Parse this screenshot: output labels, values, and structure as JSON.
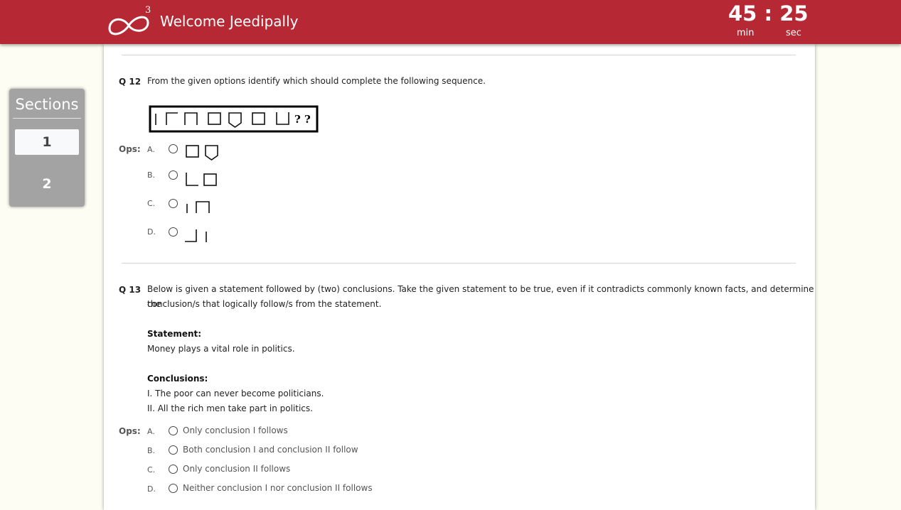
{
  "header": {
    "logo_superscript": "3",
    "welcome": "Welcome Jeedipally",
    "timer": {
      "minutes": "45",
      "separator": ":",
      "seconds": "25",
      "min_label": "min",
      "sec_label": "sec"
    }
  },
  "sidebar": {
    "title": "Sections",
    "items": [
      {
        "label": "1",
        "active": true
      },
      {
        "label": "2",
        "active": false
      }
    ]
  },
  "questions": [
    {
      "number": "Q 12",
      "text": "From the given options identify which should complete the following sequence.",
      "sequence_figure": {
        "shapes": [
          "vertical-bar",
          "corner-top-left",
          "open-bottom-square",
          "square",
          "shield",
          "square",
          "open-top-square"
        ],
        "unknown": "? ?"
      },
      "ops_label": "Ops:",
      "options": [
        {
          "letter": "A.",
          "figure": [
            "square",
            "shield"
          ]
        },
        {
          "letter": "B.",
          "figure": [
            "corner-bottom-left",
            "square"
          ]
        },
        {
          "letter": "C.",
          "figure": [
            "vertical-bar",
            "open-bottom-square"
          ]
        },
        {
          "letter": "D.",
          "figure": [
            "corner-bottom-right",
            "vertical-bar"
          ]
        }
      ]
    },
    {
      "number": "Q 13",
      "text_line1": "Below is given a statement followed by (two) conclusions. Take the given statement to be true, even if it contradicts commonly known facts, and determine the",
      "text_line2": "conclusion/s that logically follow/s from the statement.",
      "statement_label": "Statement:",
      "statement": "Money plays a vital role in politics.",
      "conclusions_label": "Conclusions:",
      "conclusions": [
        "I. The poor can never become politicians.",
        "II. All the rich men take part in politics."
      ],
      "ops_label": "Ops:",
      "options": [
        {
          "letter": "A.",
          "text": "Only conclusion I follows"
        },
        {
          "letter": "B.",
          "text": "Both conclusion I and conclusion II follow"
        },
        {
          "letter": "C.",
          "text": "Only conclusion II follows"
        },
        {
          "letter": "D.",
          "text": "Neither conclusion I nor conclusion II follows"
        }
      ]
    }
  ],
  "colors": {
    "header_bg": "#b62833",
    "page_bg": "#fdfdf3",
    "sidebar_bg": "#a3a3a3"
  }
}
